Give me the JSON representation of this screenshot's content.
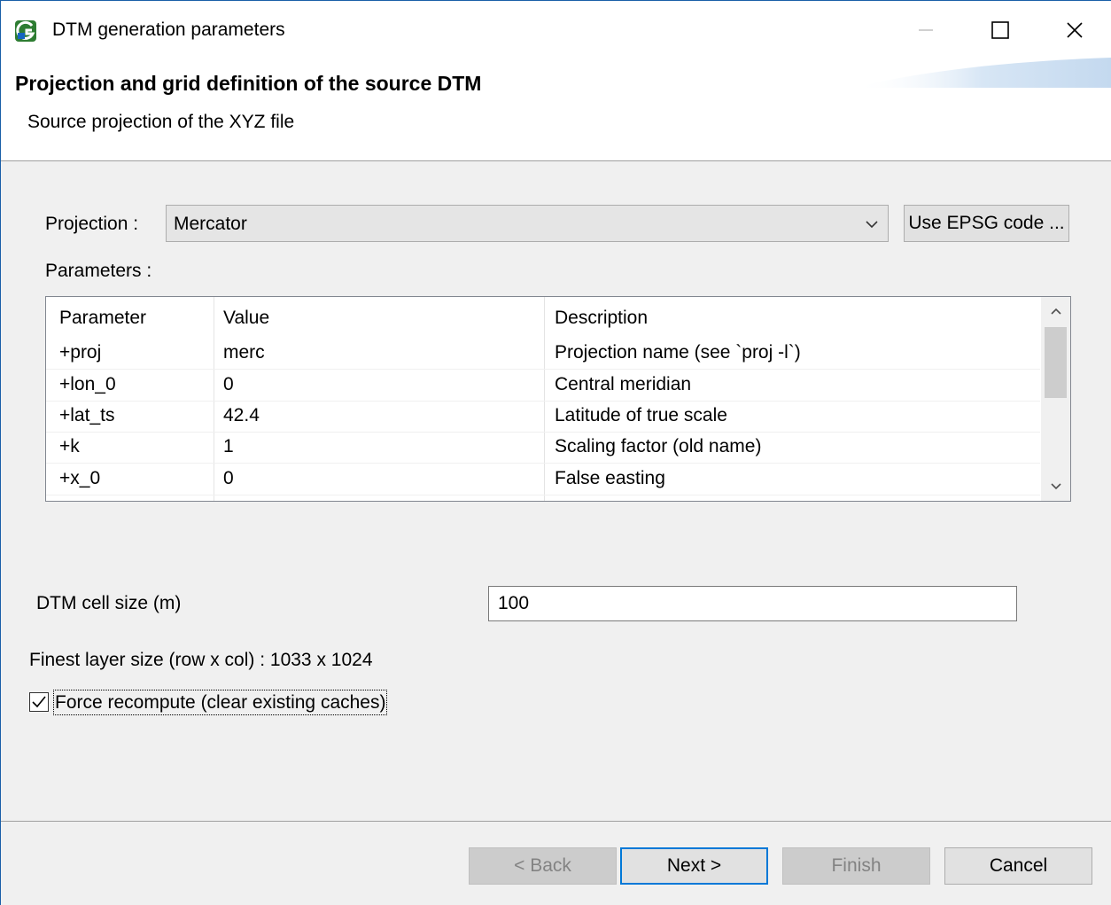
{
  "window": {
    "title": "DTM generation parameters",
    "app_icon": "green-g-app-icon",
    "controls": {
      "minimize": "minimize-icon",
      "maximize": "maximize-icon",
      "close": "close-icon"
    }
  },
  "header": {
    "title": "Projection and grid definition of the source DTM",
    "subtitle": "Source projection of the XYZ file"
  },
  "projection": {
    "label": "Projection :",
    "selected": "Mercator",
    "epsg_button": "Use EPSG code ..."
  },
  "parameters": {
    "label": "Parameters :",
    "columns": [
      "Parameter",
      "Value",
      "Description"
    ],
    "rows": [
      [
        "+proj",
        "merc",
        "Projection name (see `proj -l`)"
      ],
      [
        "+lon_0",
        "0",
        "Central meridian"
      ],
      [
        "+lat_ts",
        "42.4",
        "Latitude of true scale"
      ],
      [
        "+k",
        "1",
        "Scaling factor (old name)"
      ],
      [
        "+x_0",
        "0",
        "False easting"
      ]
    ]
  },
  "cell_size": {
    "label": "DTM cell size (m)",
    "value": "100"
  },
  "finest_layer": "Finest layer size (row x col) : 1033 x 1024",
  "force_recompute": {
    "label": "Force recompute (clear existing caches)",
    "checked": true
  },
  "footer": {
    "back": "< Back",
    "next": "Next >",
    "finish": "Finish",
    "cancel": "Cancel"
  },
  "colors": {
    "accent": "#0078d7",
    "body_bg": "#f0f0f0",
    "app_icon_green": "#3a8f3a"
  }
}
